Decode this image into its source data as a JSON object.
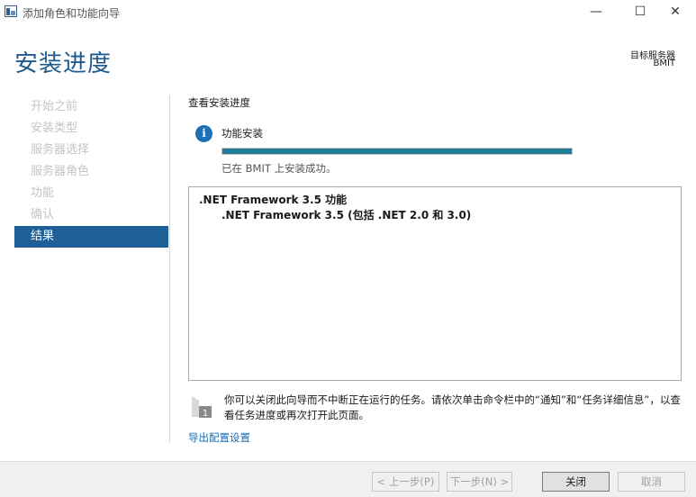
{
  "window": {
    "title": "添加角色和功能向导",
    "minimize_glyph": "—",
    "maximize_glyph": "☐",
    "close_glyph": "✕"
  },
  "header": {
    "page_title": "安装进度",
    "target_server_label": "目标服务器",
    "target_server_name": "BMIT"
  },
  "nav": {
    "items": [
      {
        "label": "开始之前",
        "state": "disabled"
      },
      {
        "label": "安装类型",
        "state": "disabled"
      },
      {
        "label": "服务器选择",
        "state": "disabled"
      },
      {
        "label": "服务器角色",
        "state": "disabled"
      },
      {
        "label": "功能",
        "state": "disabled"
      },
      {
        "label": "确认",
        "state": "disabled"
      },
      {
        "label": "结果",
        "state": "active"
      }
    ]
  },
  "main": {
    "section_heading": "查看安装进度",
    "info_icon": "info-icon",
    "feature_install_label": "功能安装",
    "progress_fraction": 1.0,
    "status_text": "已在 BMIT 上安装成功。",
    "results": [
      ".NET Framework 3.5 功能",
      ".NET Framework 3.5 (包括 .NET 2.0 和 3.0)"
    ],
    "note_text": "你可以关闭此向导而不中断正在运行的任务。请依次单击命令栏中的“通知”和“任务详细信息”，以查看任务进度或再次打开此页面。",
    "note_icon_number": "1",
    "export_link": "导出配置设置"
  },
  "footer": {
    "prev_label": "< 上一步(P)",
    "next_label": "下一步(N) >",
    "close_label": "关闭",
    "cancel_label": "取消"
  },
  "colors": {
    "accent": "#1f5f97",
    "title": "#1e5a8e",
    "progress": "#1f7a93",
    "link": "#1a6ab5",
    "info": "#1e6fb8"
  }
}
